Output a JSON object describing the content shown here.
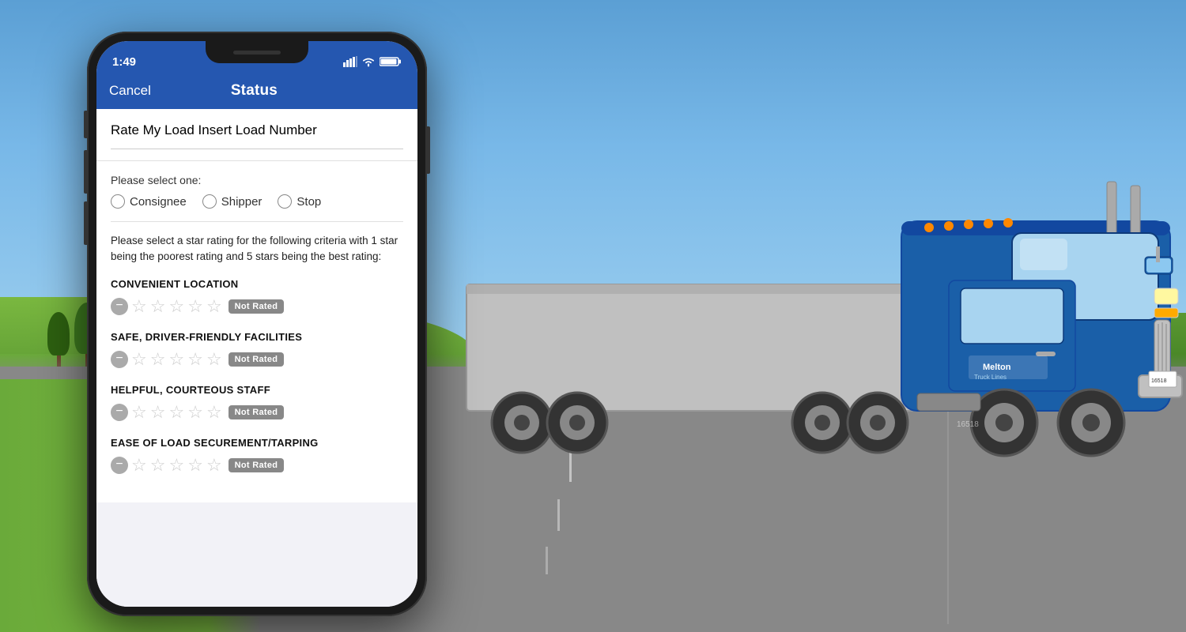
{
  "background": {
    "sky_color": "#7ABDE0",
    "road_color": "#888888",
    "grass_color": "#6aaa3a"
  },
  "status_bar": {
    "time": "1:49",
    "signal_bars": "▋▋▋",
    "wifi_icon": "wifi",
    "battery_icon": "battery"
  },
  "nav": {
    "cancel_label": "Cancel",
    "title": "Status"
  },
  "load_section": {
    "title": "Rate My Load Insert Load Number"
  },
  "select_one": {
    "label": "Please select one:",
    "options": [
      {
        "id": "consignee",
        "label": "Consignee",
        "selected": false
      },
      {
        "id": "shipper",
        "label": "Shipper",
        "selected": false
      },
      {
        "id": "stop",
        "label": "Stop",
        "selected": false
      }
    ]
  },
  "instruction": {
    "text": "Please select a star rating for the following criteria with 1 star being the poorest rating and 5 stars being the best rating:"
  },
  "ratings": [
    {
      "id": "convenient-location",
      "label": "CONVENIENT LOCATION",
      "stars": 0,
      "max_stars": 5,
      "badge": "Not Rated"
    },
    {
      "id": "safe-facilities",
      "label": "SAFE, DRIVER-FRIENDLY FACILITIES",
      "stars": 0,
      "max_stars": 5,
      "badge": "Not Rated"
    },
    {
      "id": "helpful-staff",
      "label": "HELPFUL, COURTEOUS STAFF",
      "stars": 0,
      "max_stars": 5,
      "badge": "Not Rated"
    },
    {
      "id": "ease-load",
      "label": "EASE OF LOAD SECUREMENT/TARPING",
      "stars": 0,
      "max_stars": 5,
      "badge": "Not Rated"
    }
  ],
  "colors": {
    "header_blue": "#2557b0",
    "badge_gray": "#888888",
    "star_empty": "#cccccc"
  }
}
